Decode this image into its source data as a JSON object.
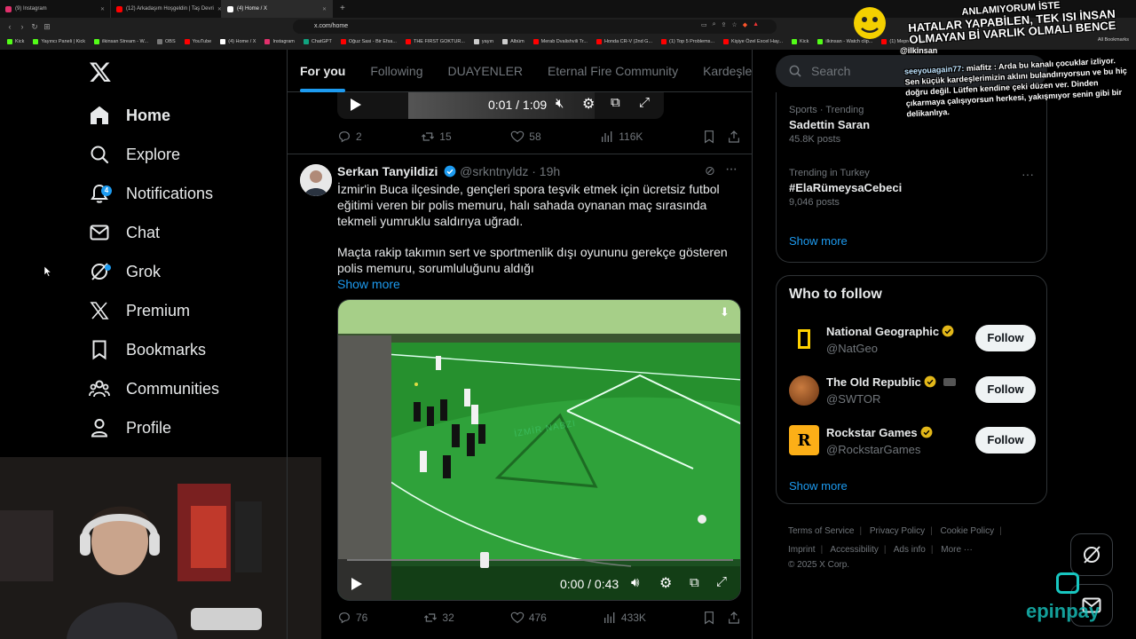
{
  "browser": {
    "tabs": [
      {
        "label": "(9) Instagram",
        "color": "#e1306c",
        "active": false
      },
      {
        "label": "(12) Arkadaşım Hoşgeldin | Taş Devri",
        "color": "#ff0000",
        "active": false
      },
      {
        "label": "(4) Home / X",
        "color": "#ffffff",
        "active": true
      }
    ],
    "url": "x.com/home",
    "bookmarks": [
      {
        "label": "Kick",
        "color": "#53fc18"
      },
      {
        "label": "Yayıncı Paneli | Kick",
        "color": "#53fc18"
      },
      {
        "label": "ilkinsan Stream - W...",
        "color": "#53fc18"
      },
      {
        "label": "OBS",
        "color": "#777777"
      },
      {
        "label": "YouTube",
        "color": "#ff0000"
      },
      {
        "label": "(4) Home / X",
        "color": "#ffffff"
      },
      {
        "label": "Instagram",
        "color": "#e1306c"
      },
      {
        "label": "ChatGPT",
        "color": "#10a37f"
      },
      {
        "label": "Oğuz Sasi - Bir Efsa...",
        "color": "#ff0000"
      },
      {
        "label": "THE FIRST GOKTUR...",
        "color": "#ff0000"
      },
      {
        "label": "yayın",
        "color": "#cccccc"
      },
      {
        "label": "Albüm",
        "color": "#cccccc"
      },
      {
        "label": "Merab Dvalishvili Tr...",
        "color": "#ff0000"
      },
      {
        "label": "Honda CR-V (2nd G...",
        "color": "#ff0000"
      },
      {
        "label": "(1) Top 5 Problems...",
        "color": "#ff0000"
      },
      {
        "label": "Kişiye Özel Excel Hay...",
        "color": "#ff0000"
      },
      {
        "label": "Kick",
        "color": "#53fc18"
      },
      {
        "label": "ilkinsan - Watch clip...",
        "color": "#53fc18"
      },
      {
        "label": "(1) Meprez Official -...",
        "color": "#ff0000"
      }
    ],
    "all_bookmarks": "All Bookmarks"
  },
  "sidebar": {
    "items": [
      {
        "label": "Home",
        "icon": "home-icon"
      },
      {
        "label": "Explore",
        "icon": "search-icon"
      },
      {
        "label": "Notifications",
        "icon": "bell-icon",
        "badge": "4"
      },
      {
        "label": "Chat",
        "icon": "mail-icon"
      },
      {
        "label": "Grok",
        "icon": "grok-icon"
      },
      {
        "label": "Premium",
        "icon": "x-logo-icon"
      },
      {
        "label": "Bookmarks",
        "icon": "bookmark-icon"
      },
      {
        "label": "Communities",
        "icon": "communities-icon"
      },
      {
        "label": "Profile",
        "icon": "person-icon"
      }
    ]
  },
  "feed": {
    "tabs": [
      "For you",
      "Following",
      "DUAYENLER",
      "Eternal Fire Community",
      "Kardeşler K"
    ],
    "post1": {
      "video_time": "0:01 / 1:09",
      "replies": "2",
      "reposts": "15",
      "likes": "58",
      "views": "116K"
    },
    "post2": {
      "name": "Serkan Tanyildizi",
      "handle": "@srkntnyldz",
      "time": "· 19h",
      "text1": "İzmir'in Buca ilçesinde, gençleri spora teşvik etmek için ücretsiz futbol eğitimi veren bir polis memuru, halı sahada oynanan maç sırasında tekmeli yumruklu saldırıya uğradı.",
      "text2": "Maçta rakip takımın sert ve sportmenlik dışı oyununu gerekçe gösteren polis memuru, sorumluluğunu aldığı",
      "show_more": "Show more",
      "video_watermark": "İZMİR NABZI",
      "video_time": "0:00 / 0:43",
      "video_progress": 0.0,
      "replies": "76",
      "reposts": "32",
      "likes": "476",
      "views": "433K"
    }
  },
  "right": {
    "search_placeholder": "Search",
    "trends": [
      {
        "context": "Sports · Trending",
        "name": "Sadettin Saran",
        "posts": "45.8K posts"
      },
      {
        "context": "Trending in Turkey",
        "name": "#ElaRümeysaCebeci",
        "posts": "9,046 posts"
      }
    ],
    "trends_show_more": "Show more",
    "who_title": "Who to follow",
    "who": [
      {
        "name": "National Geographic",
        "handle": "@NatGeo",
        "button": "Follow"
      },
      {
        "name": "The Old Republic",
        "handle": "@SWTOR",
        "button": "Follow"
      },
      {
        "name": "Rockstar Games",
        "handle": "@RockstarGames",
        "button": "Follow"
      }
    ],
    "who_show_more": "Show more",
    "footer": [
      "Terms of Service",
      "Privacy Policy",
      "Cookie Policy",
      "Imprint",
      "Accessibility",
      "Ads info",
      "More ···",
      "© 2025 X Corp."
    ]
  },
  "overlay": {
    "meme_lines": [
      "ANLAMIYORUM İSTE",
      "HATALAR YAPABİLEN, TEK ISI İNSAN",
      "OLMAYAN Bİ VARLIK OLMALI BENCE"
    ],
    "meme_user": "@ilkinsan",
    "chat_user": "seeyouagain77:",
    "chat_text": "miafitz : Arda bu kanalı çocuklar izliyor. Sen küçük kardeşlerimizin aklını bulandırıyorsun ve bu hiç doğru değil. Lütfen kendine çeki düzen ver. Dinden çıkarmaya çalışıyorsun herkesi, yakışmıyor senin gibi bir delikanlıya.",
    "sponsor": "epinpay"
  }
}
